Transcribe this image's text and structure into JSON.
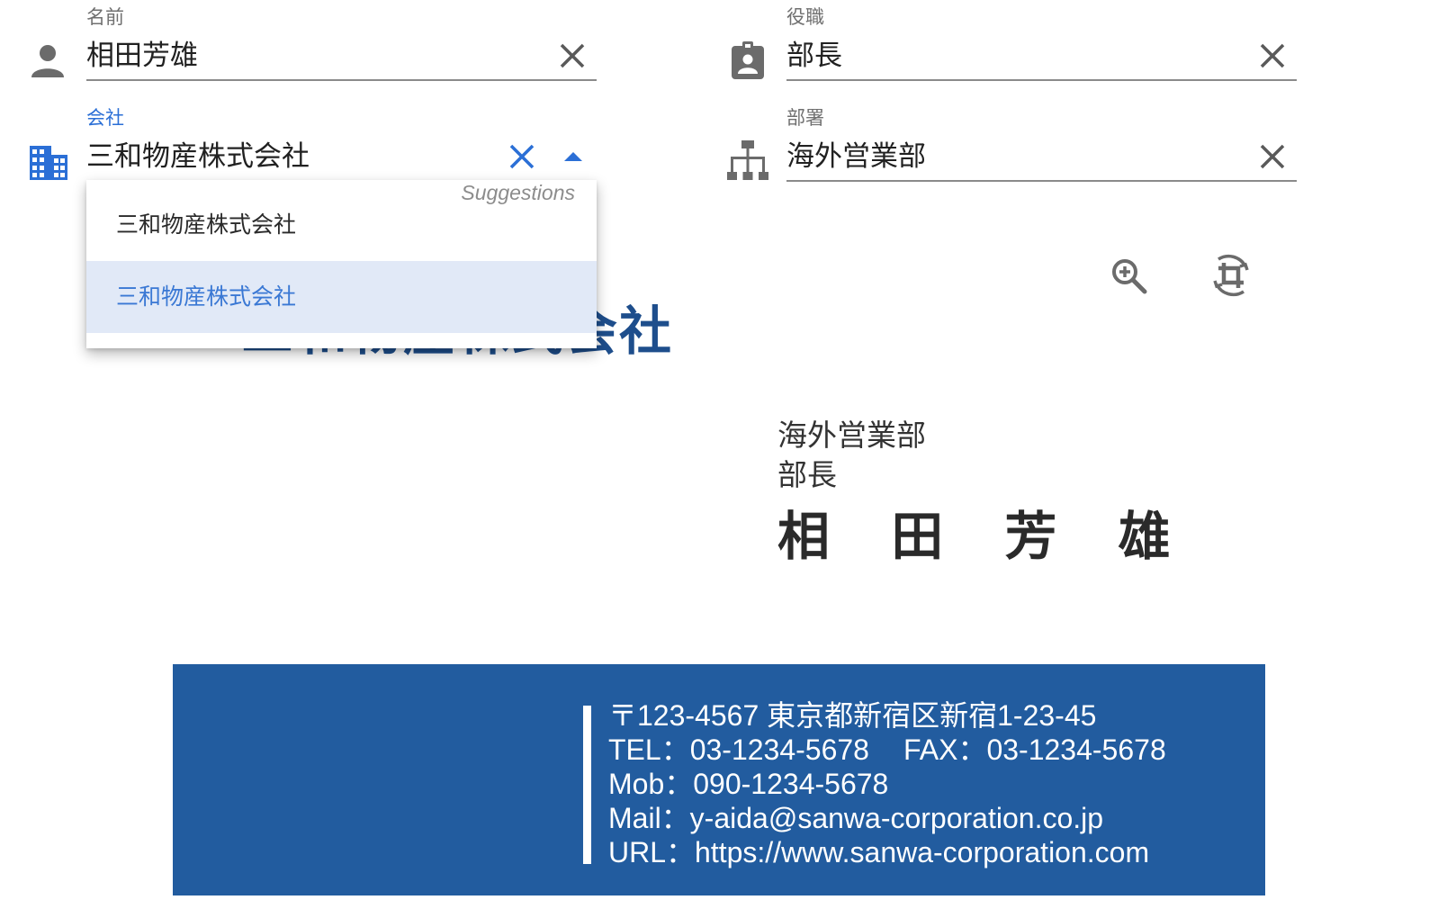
{
  "fields": {
    "name": {
      "label": "名前",
      "value": "相田芳雄",
      "icon": "person-icon"
    },
    "title": {
      "label": "役職",
      "value": "部長",
      "icon": "badge-icon"
    },
    "company": {
      "label": "会社",
      "value": "三和物産株式会社",
      "icon": "building-icon"
    },
    "department": {
      "label": "部署",
      "value": "海外営業部",
      "icon": "org-chart-icon"
    }
  },
  "dropdown": {
    "header": "Suggestions",
    "items": [
      "三和物産株式会社",
      "三和物産株式会社"
    ],
    "highlighted_index": 1
  },
  "toolbar": {
    "zoom_icon": "zoom-in-icon",
    "crop_icon": "crop-rotate-icon"
  },
  "card": {
    "company": "三和物産株式会社",
    "department": "海外営業部",
    "title": "部長",
    "name": "相 田 芳 雄",
    "address": "〒123-4567 東京都新宿区新宿1-23-45",
    "tel": "TEL：03-1234-5678",
    "fax": "FAX：03-1234-5678",
    "mobile": "Mob：090-1234-5678",
    "mail": "Mail：y-aida@sanwa-corporation.co.jp",
    "url": "URL：https://www.sanwa-corporation.com"
  },
  "colors": {
    "accent": "#2b6fd6",
    "card_blue": "#225c9f",
    "highlight_bg": "#e1e9f7",
    "icon_gray": "#6b6b6b"
  }
}
